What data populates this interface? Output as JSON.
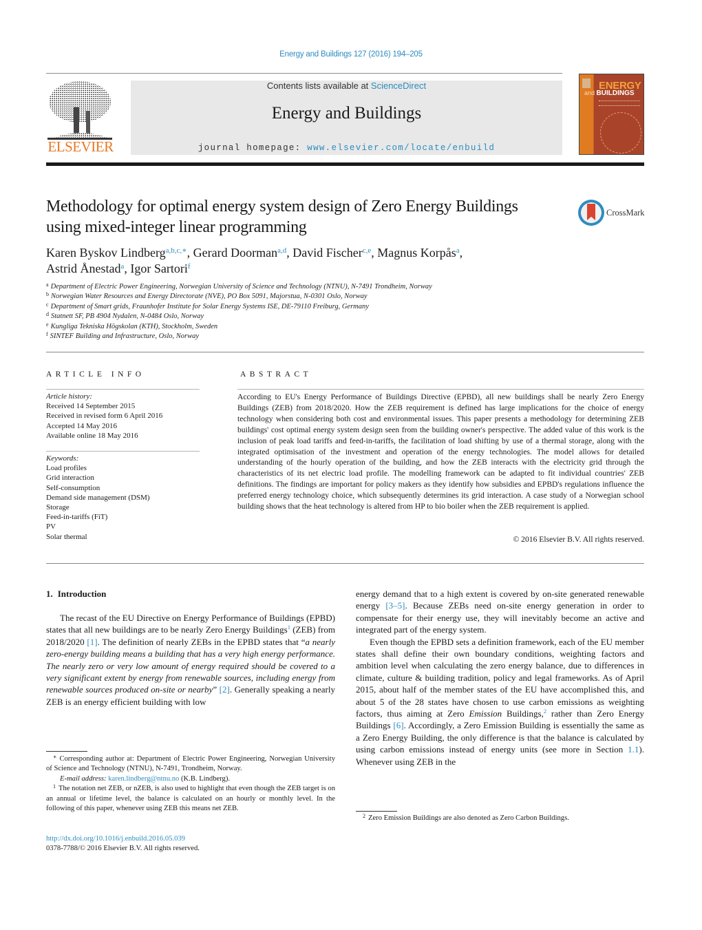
{
  "header": {
    "journal_ref": "Energy and Buildings 127 (2016) 194–205",
    "contents_prefix": "Contents lists available at ",
    "contents_link": "ScienceDirect",
    "journal_title": "Energy and Buildings",
    "homepage_prefix": "journal homepage: ",
    "homepage_link": "www.elsevier.com/locate/enbuild",
    "publisher_logo_text": "ELSEVIER",
    "cover": {
      "title_line1": "ENERGY",
      "title_and": "and",
      "title_line2": "BUILDINGS"
    },
    "colors": {
      "link": "#2a8bbf",
      "publisher_orange": "#e87722",
      "cover_red": "#a9442a"
    }
  },
  "article": {
    "title": "Methodology for optimal energy system design of Zero Energy Buildings using mixed-integer linear programming",
    "crossmark_label": "CrossMark",
    "authors": [
      {
        "name": "Karen Byskov Lindberg",
        "affils": "a,b,c,∗"
      },
      {
        "name": "Gerard Doorman",
        "affils": "a,d"
      },
      {
        "name": "David Fischer",
        "affils": "c,e"
      },
      {
        "name": "Magnus Korpås",
        "affils": "a"
      },
      {
        "name": "Astrid Ånestad",
        "affils": "a"
      },
      {
        "name": "Igor Sartori",
        "affils": "f"
      }
    ],
    "affiliations": [
      {
        "key": "a",
        "text": "Department of Electric Power Engineering, Norwegian University of Science and Technology (NTNU), N-7491 Trondheim, Norway"
      },
      {
        "key": "b",
        "text": "Norwegian Water Resources and Energy Directorate (NVE), PO Box 5091, Majorstua, N-0301 Oslo, Norway"
      },
      {
        "key": "c",
        "text": "Department of Smart grids, Fraunhofer Institute for Solar Energy Systems ISE, DE-79110 Freiburg, Germany"
      },
      {
        "key": "d",
        "text": "Statnett SF, PB 4904 Nydalen, N-0484 Oslo, Norway"
      },
      {
        "key": "e",
        "text": "Kungliga Tekniska Högskolan (KTH), Stockholm, Sweden"
      },
      {
        "key": "f",
        "text": "SINTEF Building and Infrastructure, Oslo, Norway"
      }
    ]
  },
  "article_info": {
    "heading": "ARTICLE INFO",
    "history_label": "Article history:",
    "history": [
      "Received 14 September 2015",
      "Received in revised form 6 April 2016",
      "Accepted 14 May 2016",
      "Available online 18 May 2016"
    ],
    "keywords_label": "Keywords:",
    "keywords": [
      "Load profiles",
      "Grid interaction",
      "Self-consumption",
      "Demand side management (DSM)",
      "Storage",
      "Feed-in-tariffs (FiT)",
      "PV",
      "Solar thermal"
    ]
  },
  "abstract": {
    "heading": "ABSTRACT",
    "text": "According to EU's Energy Performance of Buildings Directive (EPBD), all new buildings shall be nearly Zero Energy Buildings (ZEB) from 2018/2020. How the ZEB requirement is defined has large implications for the choice of energy technology when considering both cost and environmental issues. This paper presents a methodology for determining ZEB buildings' cost optimal energy system design seen from the building owner's perspective. The added value of this work is the inclusion of peak load tariffs and feed-in-tariffs, the facilitation of load shifting by use of a thermal storage, along with the integrated optimisation of the investment and operation of the energy technologies. The model allows for detailed understanding of the hourly operation of the building, and how the ZEB interacts with the electricity grid through the characteristics of its net electric load profile. The modelling framework can be adapted to fit individual countries' ZEB definitions. The findings are important for policy makers as they identify how subsidies and EPBD's regulations influence the preferred energy technology choice, which subsequently determines its grid interaction. A case study of a Norwegian school building shows that the heat technology is altered from HP to bio boiler when the ZEB requirement is applied.",
    "copyright": "© 2016 Elsevier B.V. All rights reserved."
  },
  "body": {
    "section_number": "1.",
    "section_title": "Introduction",
    "col1": {
      "p1_a": "The recast of the EU Directive on Energy Performance of Buildings (EPBD) states that all new buildings are to be nearly Zero Energy Buildings",
      "p1_fn": "1",
      "p1_b": " (ZEB) from 2018/2020 ",
      "p1_ref1": "[1]",
      "p1_c": ". The definition of nearly ZEBs in the EPBD states that “",
      "p1_quote": "a nearly zero-energy building means a building that has a very high energy performance. The nearly zero or very low amount of energy required should be covered to a very significant extent by energy from renewable sources, including energy from renewable sources produced on-site or nearby",
      "p1_d": "” ",
      "p1_ref2": "[2]",
      "p1_e": ". Generally speaking a nearly ZEB is an energy efficient building with low"
    },
    "col2": {
      "p1_a": "energy demand that to a high extent is covered by on-site generated renewable energy ",
      "p1_ref": "[3–5]",
      "p1_b": ". Because ZEBs need on-site energy generation in order to compensate for their energy use, they will inevitably become an active and integrated part of the energy system.",
      "p2_a": "Even though the EPBD sets a definition framework, each of the EU member states shall define their own boundary conditions, weighting factors and ambition level when calculating the zero energy balance, due to differences in climate, culture & building tradition, policy and legal frameworks. As of April 2015, about half of the member states of the EU have accomplished this, and about 5 of the 28 states have chosen to use carbon emissions as weighting factors, thus aiming at Zero ",
      "p2_em": "Emission",
      "p2_b": " Buildings,",
      "p2_fn": "2",
      "p2_c": " rather than Zero Energy Buildings ",
      "p2_ref": "[6]",
      "p2_d": ". Accordingly, a Zero Emission Building is essentially the same as a Zero Energy Building, the only difference is that the balance is calculated by using carbon emissions instead of energy units (see more in Section ",
      "p2_sec": "1.1",
      "p2_e": "). Whenever using ZEB in the"
    }
  },
  "footnotes": {
    "corresponding_mark": "∗",
    "corresponding": "Corresponding author at: Department of Electric Power Engineering, Norwegian University of Science and Technology (NTNU), N-7491, Trondheim, Norway.",
    "email_label": "E-mail address: ",
    "email": "karen.lindberg@ntnu.no",
    "email_suffix": " (K.B. Lindberg).",
    "fn1_mark": "1",
    "fn1": "The notation net ZEB, or nZEB, is also used to highlight that even though the ZEB target is on an annual or lifetime level, the balance is calculated on an hourly or monthly level. In the following of this paper, whenever using ZEB this means net ZEB.",
    "fn2_mark": "2",
    "fn2": "Zero Emission Buildings are also denoted as Zero Carbon Buildings.",
    "doi": "http://dx.doi.org/10.1016/j.enbuild.2016.05.039",
    "issn_line": "0378-7788/© 2016 Elsevier B.V. All rights reserved."
  }
}
